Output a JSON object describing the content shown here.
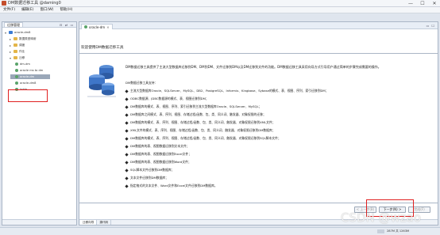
{
  "window": {
    "title": "DM数据迁移工具 @daming0",
    "min": "—",
    "max": "☐",
    "close": "✕"
  },
  "menu": [
    "文件(F)",
    "编辑(E)",
    "窗口(W)",
    "帮助(H)"
  ],
  "left_panel": {
    "tab": "迁移管理",
    "tree": [
      {
        "label": "oracle-dm8",
        "twisty": "▾",
        "icon": "db"
      },
      {
        "label": "数据类型映射",
        "twisty": "▸",
        "icon": "folder"
      },
      {
        "label": "调度",
        "twisty": "▸",
        "icon": "folder"
      },
      {
        "label": "作业",
        "twisty": "▸",
        "icon": "folder"
      },
      {
        "label": "迁移",
        "twisty": "▾",
        "icon": "folder"
      },
      {
        "label": "dm-dm",
        "twisty": "",
        "icon": "mig"
      },
      {
        "label": "oracle ms to dm",
        "twisty": "",
        "icon": "mig"
      },
      {
        "label": "oracle-dm",
        "twisty": "",
        "icon": "mig",
        "selected": true
      },
      {
        "label": "oracle-dm8",
        "twisty": "",
        "icon": "mig"
      },
      {
        "label": "table",
        "twisty": "",
        "icon": "mig"
      }
    ]
  },
  "editor": {
    "tab": "oracle-dm",
    "welcome": "欢迎使用DM数据迁移工具",
    "intro": "DM数据迁移工具提供了主流大型数据库迁移到DM、DM到DM、文件迁移到DM以及DM迁移到文件的功能。DM数据迁移工具采用向导方式引导用户通过简单的步骤完成需要的操作。",
    "support_title": "DM数据迁移工具支持：",
    "features": [
      "主流大型数据库Oracle、SQLServer、MySQL、DB2、PostgreSQL、Informix、Kingbase、Sybase的模式、表、视图、序列、索引迁移到DM；",
      "ODBC数据源、JDBC数据源的模式、表、视图迁移到DM；",
      "DM数据库的模式、表、视图、序列、索引迁移到主流大型数据库Oracle、SQLServer、MySQL；",
      "DM数据库之间模式、表、序列、视图、存储过程/函数、包、类、同义词、触发器、对象权限的迁移；",
      "DM数据库的模式、表、序列、视图、存储过程/函数、包、类、同义词、触发器、对象权限迁移到XML文件；",
      "XML文件的模式、表、序列、视图、存储过程/函数、包、类、同义词、触发器、对象权限迁移到DM数据库；",
      "DM数据库的模式、表、序列、视图、存储过程/函数、包、类、同义词、触发器、对象权限迁移到SQL脚本文件；",
      "DM数据库的表、视图数据迁移到文本文件；",
      "DM数据库的表、视图数据迁移到Excel文件；",
      "DM数据库的表、视图数据迁移到Word文件；",
      "SQL脚本文件迁移到DM数据库；",
      "文本文件迁移到DM数据库；",
      "指定格式的文本文件、Word文件和Excel文件迁移到DM数据库。"
    ],
    "buttons": {
      "back": "< 上一步(B)",
      "next": "下一步(N) >",
      "finish": "完成(F)"
    },
    "bottom_tabs": [
      "迁移向导",
      "源代码"
    ]
  },
  "status": {
    "memory": "287M 共 1263M"
  },
  "watermark": "CSDN @wzao"
}
